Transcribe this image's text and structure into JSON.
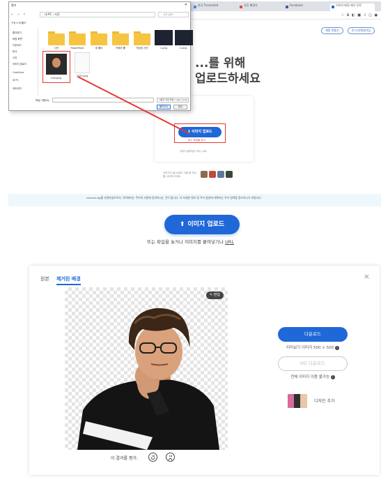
{
  "browser": {
    "tabs": [
      {
        "label": "한국 Translated",
        "color": "#4285f4"
      },
      {
        "label": "사진 배경지",
        "color": "#e8453c"
      },
      {
        "label": "Facebook",
        "color": "#3b5998"
      },
      {
        "label": "이미지 배경 제거 무료",
        "color": "#2067d8"
      }
    ],
    "ext_icons": "☆ ⧉ ◧ ■ ⇩ ◫ ●",
    "site_buttons": {
      "signup": "계정 만들기",
      "login": "로그인/회원가입"
    },
    "hero_line1": "...를 위해",
    "hero_line2": "업로드하세요",
    "card_upload_label": "이미지 업로드",
    "card_sub": "또는 파일을 놓기",
    "card_paste_hint": "이미지 붙여넣기 또는 URL",
    "samples_hint": "이미지가 없으세요? 다음 중 하나를 시도해 보세요:",
    "cookie_text": "remove.bg를 사용하실으로서, 귀하께서는 쿠키의 사용에 동의하시는 것이 됩니다. 더 자세한 정보 및 쿠키 옵션에 대해서는 쿠키 정책을 참조하시기 바랍니다."
  },
  "dialog": {
    "title": "열기",
    "address": "내 PC › 사진",
    "search_placeholder": "사진 검색",
    "nav_arrows": "← → ↑",
    "toolbar": "구성 ▾    새 폴더",
    "nav_items": [
      "즐겨찾기",
      "바탕 화면",
      "다운로드",
      "문서",
      "사진",
      "이미지 업로드",
      "OneDrive",
      "내 PC",
      "네트워크"
    ],
    "folders": [
      "사진",
      "PowerPoint",
      "새 폴더",
      "카메라 롤",
      "저장된 사진"
    ],
    "dark_files": [
      "1.png",
      "2.png"
    ],
    "selected_file": "nhh.png",
    "doc_file": "1024.png",
    "filename_label": "파일 이름(N):",
    "filetype": "사용자 지정 파일 (*.jpg;*.png)",
    "open_button": "열기(O)",
    "cancel_button": "취소"
  },
  "main": {
    "upload_button": "이미지 업로드",
    "drop_hint_prefix": "또는 파일을 놓거나 이미지를 붙여넣기나",
    "drop_hint_link": "URL",
    "tabs": {
      "original": "원본",
      "removed": "제거된 배경"
    },
    "close": "×",
    "edit_button": "편집",
    "download_button": "다운로드",
    "preview_info": "미리보기 이미지 500 × 500",
    "hd_button": "HD 다운로드",
    "hd_info": "전체 이미지 이용 불가능",
    "design_label": "디자인 추가",
    "rate_label": "이 결과를 평가:",
    "info_glyph": "i"
  }
}
